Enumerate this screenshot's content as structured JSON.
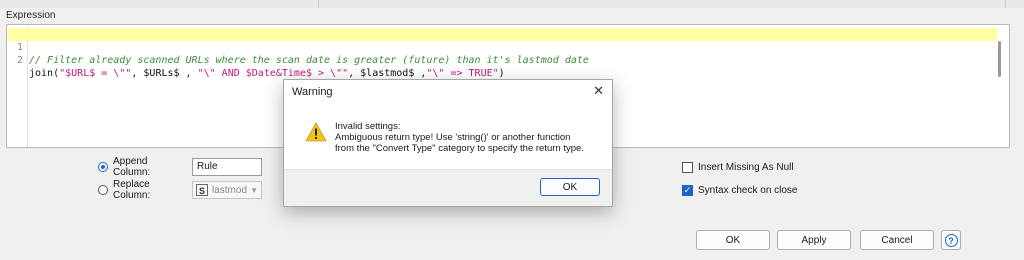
{
  "expression": {
    "label": "Expression",
    "lines": [
      {
        "number": "1",
        "comment": "// Filter already scanned URLs where the scan date is greater (future) than it's lastmod date"
      },
      {
        "number": "2",
        "parts": [
          {
            "kind": "plain",
            "text": "join("
          },
          {
            "kind": "str",
            "text": "\"$URL$ = \\\"\""
          },
          {
            "kind": "plain",
            "text": ", $URLs$ , "
          },
          {
            "kind": "str",
            "text": "\"\\\" AND $Date&Time$ > \\\"\""
          },
          {
            "kind": "plain",
            "text": ", $lastmod$ ,"
          },
          {
            "kind": "str",
            "text": "\"\\\" => TRUE\""
          },
          {
            "kind": "plain",
            "text": ")"
          }
        ]
      }
    ]
  },
  "options": {
    "append_column_label": "Append Column:",
    "append_column_value": "Rule",
    "replace_column_label": "Replace Column:",
    "replace_column_type_badge": "S",
    "replace_column_value": "lastmod",
    "insert_missing_label": "Insert Missing As Null",
    "syntax_check_label": "Syntax check on close",
    "syntax_check_checked": true,
    "insert_missing_checked": false
  },
  "buttons": {
    "ok": "OK",
    "apply": "Apply",
    "cancel": "Cancel",
    "help": "?"
  },
  "dialog": {
    "title": "Warning",
    "close_glyph": "✕",
    "message_lines": [
      "Invalid settings:",
      "Ambiguous return type! Use 'string()' or another function",
      "from the \"Convert Type\" category to specify the return type."
    ],
    "ok_label": "OK"
  },
  "colors": {
    "accent": "#1e64c8",
    "highlight": "#ffffa6",
    "comment": "#3c8c3c",
    "string": "#c0187d"
  }
}
